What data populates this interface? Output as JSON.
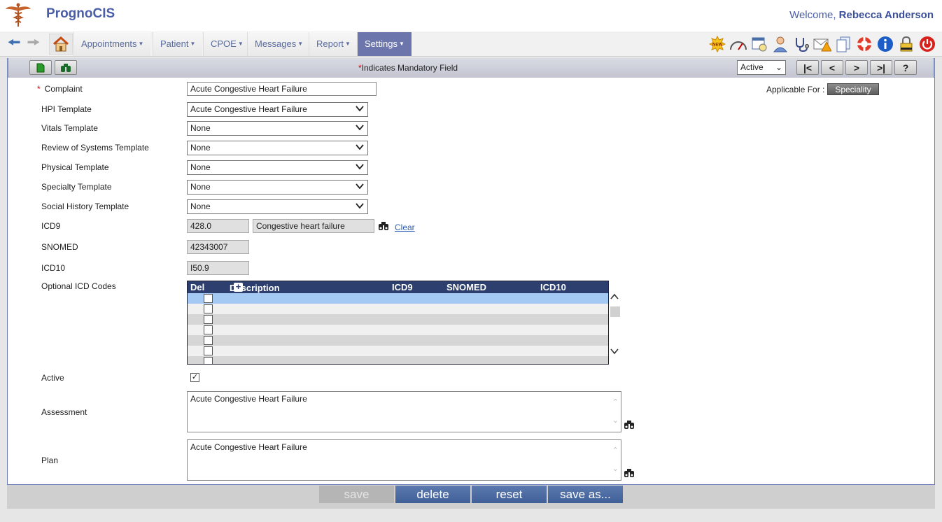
{
  "header": {
    "app_title": "PrognoCIS",
    "welcome_prefix": "Welcome,",
    "user_name": "Rebecca Anderson"
  },
  "nav": {
    "menus": [
      {
        "label": "Appointments",
        "active": false
      },
      {
        "label": "Patient",
        "active": false
      },
      {
        "label": "CPOE",
        "active": false
      },
      {
        "label": "Messages",
        "active": false
      },
      {
        "label": "Report",
        "active": false
      },
      {
        "label": "Settings",
        "active": true
      }
    ],
    "new_badge": "NEW"
  },
  "toolbar": {
    "mandatory_star": "*",
    "mandatory_text": "Indicates Mandatory Field",
    "status_value": "Active",
    "nav_buttons": [
      "|<",
      "<",
      ">",
      ">|",
      "?"
    ]
  },
  "form": {
    "complaint": {
      "label": "Complaint",
      "value": "Acute Congestive Heart Failure"
    },
    "applicable_for": {
      "label": "Applicable For :",
      "button": "Speciality"
    },
    "hpi_template": {
      "label": "HPI Template",
      "value": "Acute Congestive Heart Failure"
    },
    "vitals_template": {
      "label": "Vitals Template",
      "value": "None"
    },
    "ros_template": {
      "label": "Review of Systems Template",
      "value": "None"
    },
    "physical_template": {
      "label": "Physical Template",
      "value": "None"
    },
    "specialty_template": {
      "label": "Specialty Template",
      "value": "None"
    },
    "social_history_template": {
      "label": "Social History Template",
      "value": "None"
    },
    "icd9": {
      "label": "ICD9",
      "code": "428.0",
      "description": "Congestive heart failure",
      "clear": "Clear"
    },
    "snomed": {
      "label": "SNOMED",
      "value": "42343007"
    },
    "icd10": {
      "label": "ICD10",
      "value": "I50.9"
    },
    "optional_icd": {
      "label": "Optional ICD Codes",
      "columns": [
        "Del",
        "Description",
        "ICD9",
        "SNOMED",
        "ICD10"
      ]
    },
    "active": {
      "label": "Active"
    },
    "assessment": {
      "label": "Assessment",
      "value": "Acute Congestive Heart Failure"
    },
    "plan": {
      "label": "Plan",
      "value": "Acute Congestive Heart Failure"
    }
  },
  "footer": {
    "save": "save",
    "delete": "delete",
    "reset": "reset",
    "save_as": "save as..."
  }
}
